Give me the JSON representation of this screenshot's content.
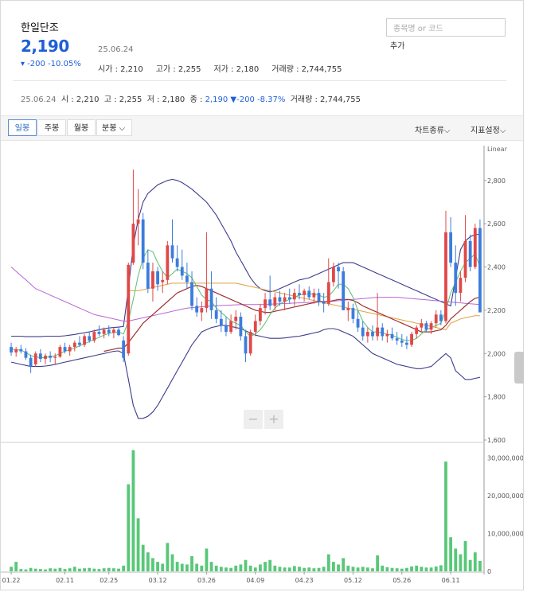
{
  "stock": {
    "name": "한일단조",
    "price": "2,190",
    "change": "-200 -10.05%",
    "date": "25.06.24",
    "open": "시가 : 2,210",
    "high": "고가 : 2,255",
    "low": "저가 : 2,180",
    "volume": "거래량 : 2,744,755"
  },
  "search": {
    "placeholder": "종목명 or 코드",
    "add_label": "추가"
  },
  "ohlc_row": {
    "date": "25.06.24",
    "open": "시 : 2,210",
    "high": "고 : 2,255",
    "low": "저 : 2,180",
    "close_label": "종 : ",
    "close_value": "2,190",
    "change": "▼-200 -8.37%",
    "volume": "거래량 : 2,744,755"
  },
  "toolbar": {
    "tabs": [
      "일봉",
      "주봉",
      "월봉",
      "분봉"
    ],
    "active_tab": "일봉",
    "chart_type": "차트종류",
    "indicator_settings": "지표설정"
  },
  "colors": {
    "up": "#e04848",
    "down": "#3b7ddd",
    "accent": "#1f5fd6",
    "bollinger": "#3c3c8c",
    "volume": "#58c878"
  },
  "chart_data": {
    "type": "candlestick",
    "scale_label": "Linear",
    "price_ylim": [
      1600,
      2950
    ],
    "price_ticks": [
      1600,
      1800,
      2000,
      2200,
      2400,
      2600,
      2800
    ],
    "volume_ylim": [
      0,
      33000000
    ],
    "volume_ticks": [
      "0",
      "10,000,000",
      "20,000,000",
      "30,000,000"
    ],
    "x_tick_labels": [
      "01.22",
      "02.11",
      "02.25",
      "03.12",
      "03.26",
      "04.09",
      "04.23",
      "05.12",
      "05.26",
      "06.11"
    ],
    "x_tick_index": [
      0,
      11,
      20,
      30,
      40,
      50,
      60,
      70,
      80,
      90
    ],
    "candles": [
      [
        2030,
        2050,
        1990,
        2005
      ],
      [
        2005,
        2030,
        1985,
        2020
      ],
      [
        2020,
        2040,
        2000,
        2010
      ],
      [
        2010,
        2025,
        1970,
        1980
      ],
      [
        1980,
        1995,
        1910,
        1940
      ],
      [
        1950,
        2010,
        1940,
        2000
      ],
      [
        2000,
        2020,
        1960,
        1975
      ],
      [
        1975,
        2000,
        1950,
        1990
      ],
      [
        1990,
        2010,
        1960,
        1980
      ],
      [
        1980,
        2000,
        1950,
        1985
      ],
      [
        1985,
        2040,
        1980,
        2030
      ],
      [
        2030,
        2050,
        2000,
        2010
      ],
      [
        2010,
        2040,
        1990,
        2030
      ],
      [
        2030,
        2060,
        2010,
        2050
      ],
      [
        2050,
        2080,
        2030,
        2040
      ],
      [
        2040,
        2090,
        2030,
        2080
      ],
      [
        2080,
        2100,
        2050,
        2060
      ],
      [
        2060,
        2110,
        2050,
        2100
      ],
      [
        2100,
        2130,
        2080,
        2090
      ],
      [
        2090,
        2120,
        2070,
        2110
      ],
      [
        2110,
        2130,
        2080,
        2095
      ],
      [
        2095,
        2120,
        2070,
        2110
      ],
      [
        2110,
        2120,
        2080,
        2085
      ],
      [
        2060,
        2080,
        1960,
        1980
      ],
      [
        2000,
        2420,
        1990,
        2410
      ],
      [
        2420,
        2850,
        2410,
        2600
      ],
      [
        2600,
        2760,
        2500,
        2620
      ],
      [
        2620,
        2650,
        2390,
        2420
      ],
      [
        2420,
        2480,
        2280,
        2300
      ],
      [
        2300,
        2420,
        2240,
        2380
      ],
      [
        2380,
        2400,
        2290,
        2320
      ],
      [
        2330,
        2380,
        2280,
        2340
      ],
      [
        2340,
        2520,
        2320,
        2500
      ],
      [
        2500,
        2620,
        2420,
        2440
      ],
      [
        2440,
        2500,
        2380,
        2400
      ],
      [
        2400,
        2480,
        2340,
        2360
      ],
      [
        2360,
        2420,
        2300,
        2330
      ],
      [
        2330,
        2380,
        2200,
        2220
      ],
      [
        2220,
        2260,
        2170,
        2190
      ],
      [
        2190,
        2240,
        2150,
        2210
      ],
      [
        2210,
        2560,
        2190,
        2300
      ],
      [
        2300,
        2380,
        2160,
        2200
      ],
      [
        2200,
        2260,
        2140,
        2160
      ],
      [
        2160,
        2200,
        2100,
        2130
      ],
      [
        2130,
        2170,
        2080,
        2100
      ],
      [
        2100,
        2180,
        2090,
        2150
      ],
      [
        2150,
        2200,
        2110,
        2170
      ],
      [
        2170,
        2190,
        2060,
        2080
      ],
      [
        2080,
        2110,
        1960,
        2000
      ],
      [
        2000,
        2110,
        1990,
        2100
      ],
      [
        2100,
        2180,
        2080,
        2150
      ],
      [
        2150,
        2230,
        2130,
        2210
      ],
      [
        2210,
        2280,
        2180,
        2250
      ],
      [
        2250,
        2360,
        2200,
        2220
      ],
      [
        2220,
        2280,
        2200,
        2260
      ],
      [
        2260,
        2290,
        2220,
        2240
      ],
      [
        2240,
        2280,
        2200,
        2260
      ],
      [
        2260,
        2300,
        2230,
        2250
      ],
      [
        2250,
        2300,
        2220,
        2280
      ],
      [
        2280,
        2320,
        2250,
        2270
      ],
      [
        2270,
        2300,
        2240,
        2290
      ],
      [
        2290,
        2310,
        2250,
        2260
      ],
      [
        2260,
        2300,
        2230,
        2280
      ],
      [
        2280,
        2300,
        2220,
        2240
      ],
      [
        2240,
        2280,
        2190,
        2230
      ],
      [
        2230,
        2440,
        2220,
        2330
      ],
      [
        2330,
        2420,
        2310,
        2400
      ],
      [
        2400,
        2420,
        2300,
        2380
      ],
      [
        2380,
        2400,
        2200,
        2200
      ],
      [
        2200,
        2240,
        2150,
        2210
      ],
      [
        2210,
        2230,
        2140,
        2160
      ],
      [
        2160,
        2200,
        2100,
        2120
      ],
      [
        2120,
        2150,
        2060,
        2080
      ],
      [
        2080,
        2120,
        2050,
        2100
      ],
      [
        2100,
        2130,
        2060,
        2080
      ],
      [
        2080,
        2280,
        2060,
        2120
      ],
      [
        2120,
        2140,
        2060,
        2080
      ],
      [
        2080,
        2110,
        2050,
        2090
      ],
      [
        2090,
        2120,
        2060,
        2070
      ],
      [
        2070,
        2100,
        2040,
        2060
      ],
      [
        2060,
        2090,
        2030,
        2050
      ],
      [
        2050,
        2080,
        2020,
        2040
      ],
      [
        2040,
        2100,
        2030,
        2090
      ],
      [
        2090,
        2130,
        2070,
        2120
      ],
      [
        2120,
        2160,
        2100,
        2140
      ],
      [
        2140,
        2150,
        2100,
        2110
      ],
      [
        2110,
        2150,
        2090,
        2140
      ],
      [
        2140,
        2200,
        2120,
        2180
      ],
      [
        2180,
        2200,
        2130,
        2150
      ],
      [
        2150,
        2660,
        2140,
        2560
      ],
      [
        2560,
        2630,
        2400,
        2420
      ],
      [
        2420,
        2500,
        2220,
        2280
      ],
      [
        2280,
        2380,
        2240,
        2350
      ],
      [
        2350,
        2640,
        2330,
        2520
      ],
      [
        2520,
        2550,
        2380,
        2400
      ],
      [
        2400,
        2600,
        2390,
        2580
      ],
      [
        2580,
        2620,
        2200,
        2190
      ]
    ],
    "ma5": [
      2020,
      2018,
      2015,
      2005,
      1990,
      1985,
      1980,
      1982,
      1985,
      1990,
      2000,
      2010,
      2018,
      2025,
      2035,
      2045,
      2055,
      2065,
      2075,
      2085,
      2092,
      2098,
      2100,
      2090,
      2150,
      2250,
      2360,
      2440,
      2480,
      2470,
      2420,
      2380,
      2350,
      2370,
      2390,
      2380,
      2370,
      2350,
      2310,
      2270,
      2250,
      2240,
      2210,
      2190,
      2170,
      2150,
      2140,
      2130,
      2100,
      2080,
      2090,
      2110,
      2140,
      2180,
      2210,
      2230,
      2240,
      2250,
      2260,
      2270,
      2275,
      2275,
      2275,
      2270,
      2260,
      2265,
      2290,
      2320,
      2320,
      2300,
      2260,
      2200,
      2150,
      2120,
      2100,
      2100,
      2095,
      2090,
      2085,
      2075,
      2065,
      2060,
      2060,
      2070,
      2090,
      2110,
      2120,
      2130,
      2140,
      2200,
      2280,
      2330,
      2380,
      2420,
      2440,
      2460,
      2400
    ],
    "ma20": [
      null,
      null,
      null,
      null,
      null,
      null,
      null,
      null,
      null,
      null,
      null,
      null,
      null,
      null,
      null,
      null,
      null,
      null,
      null,
      2010,
      2015,
      2020,
      2025,
      2025,
      2050,
      2080,
      2110,
      2140,
      2160,
      2180,
      2200,
      2220,
      2240,
      2260,
      2280,
      2290,
      2300,
      2310,
      2315,
      2310,
      2300,
      2290,
      2280,
      2270,
      2260,
      2250,
      2240,
      2230,
      2220,
      2210,
      2200,
      2195,
      2190,
      2190,
      2195,
      2200,
      2205,
      2210,
      2215,
      2220,
      2225,
      2230,
      2235,
      2240,
      2240,
      2240,
      2245,
      2250,
      2250,
      2250,
      2245,
      2235,
      2220,
      2210,
      2200,
      2190,
      2180,
      2170,
      2160,
      2150,
      2140,
      2130,
      2120,
      2110,
      2100,
      2100,
      2100,
      2105,
      2110,
      2130,
      2160,
      2180,
      2200,
      2220,
      2240,
      2255,
      2260
    ],
    "ma60": [
      2400,
      2380,
      2360,
      2340,
      2320,
      2300,
      2290,
      2280,
      2270,
      2260,
      2250,
      2240,
      2230,
      2220,
      2210,
      2200,
      2190,
      2180,
      2175,
      2170,
      2165,
      2160,
      2155,
      2150,
      2150,
      2155,
      2160,
      2165,
      2170,
      2175,
      2180,
      2185,
      2190,
      2195,
      2200,
      2205,
      2210,
      2212,
      2214,
      2216,
      2218,
      2220,
      2221,
      2222,
      2223,
      2224,
      2225,
      2226,
      2226,
      2226,
      2226,
      2226,
      2227,
      2228,
      2229,
      2230,
      2231,
      2232,
      2233,
      2234,
      2235,
      2236,
      2237,
      2238,
      2239,
      2240,
      2242,
      2244,
      2246,
      2248,
      2250,
      2252,
      2254,
      2256,
      2258,
      2260,
      2260,
      2260,
      2260,
      2260,
      2258,
      2256,
      2254,
      2252,
      2250,
      2248,
      2246,
      2244,
      2242,
      2240,
      2238,
      2236,
      2234,
      2232,
      2230,
      2228,
      2226
    ],
    "ma120": [
      null,
      null,
      null,
      null,
      null,
      null,
      null,
      null,
      null,
      null,
      null,
      null,
      null,
      null,
      null,
      null,
      null,
      null,
      null,
      null,
      null,
      null,
      null,
      null,
      2290,
      2290,
      2290,
      2295,
      2300,
      2305,
      2310,
      2315,
      2320,
      2325,
      2325,
      2325,
      2325,
      2325,
      2325,
      2325,
      2325,
      2325,
      2325,
      2325,
      2325,
      2325,
      2325,
      2320,
      2315,
      2310,
      2305,
      2300,
      2295,
      2290,
      2285,
      2280,
      2275,
      2270,
      2265,
      2260,
      2255,
      2250,
      2245,
      2240,
      2235,
      2230,
      2225,
      2220,
      2215,
      2210,
      2205,
      2200,
      2195,
      2190,
      2185,
      2180,
      2175,
      2170,
      2165,
      2160,
      2155,
      2150,
      2145,
      2140,
      2135,
      2130,
      2125,
      2120,
      2115,
      2110,
      2140,
      2150,
      2160,
      2165,
      2170,
      2175,
      2175
    ],
    "bollinger_upper": [
      2080,
      2080,
      2080,
      2078,
      2078,
      2078,
      2078,
      2080,
      2080,
      2080,
      2080,
      2082,
      2085,
      2088,
      2092,
      2096,
      2100,
      2105,
      2110,
      2115,
      2118,
      2120,
      2122,
      2125,
      2300,
      2500,
      2620,
      2700,
      2740,
      2760,
      2780,
      2790,
      2800,
      2805,
      2800,
      2790,
      2775,
      2760,
      2740,
      2720,
      2700,
      2670,
      2640,
      2600,
      2560,
      2520,
      2470,
      2430,
      2390,
      2350,
      2320,
      2300,
      2290,
      2285,
      2290,
      2300,
      2310,
      2320,
      2330,
      2340,
      2345,
      2350,
      2360,
      2370,
      2380,
      2390,
      2400,
      2410,
      2420,
      2420,
      2420,
      2410,
      2400,
      2390,
      2380,
      2370,
      2360,
      2350,
      2340,
      2330,
      2320,
      2310,
      2300,
      2290,
      2280,
      2270,
      2260,
      2250,
      2240,
      2230,
      2220,
      2350,
      2480,
      2520,
      2540,
      2550,
      2550
    ],
    "bollinger_lower": [
      1960,
      1955,
      1950,
      1945,
      1940,
      1940,
      1940,
      1942,
      1945,
      1950,
      1955,
      1960,
      1965,
      1970,
      1975,
      1980,
      1985,
      1990,
      1995,
      2000,
      2005,
      2010,
      2012,
      2000,
      1880,
      1760,
      1700,
      1700,
      1710,
      1730,
      1760,
      1800,
      1840,
      1880,
      1920,
      1960,
      2000,
      2040,
      2070,
      2100,
      2110,
      2120,
      2125,
      2130,
      2130,
      2125,
      2120,
      2115,
      2105,
      2095,
      2085,
      2080,
      2075,
      2070,
      2070,
      2070,
      2072,
      2075,
      2078,
      2080,
      2085,
      2090,
      2095,
      2100,
      2110,
      2115,
      2115,
      2110,
      2100,
      2090,
      2080,
      2060,
      2040,
      2020,
      2000,
      1990,
      1980,
      1970,
      1960,
      1950,
      1945,
      1940,
      1935,
      1930,
      1930,
      1935,
      1940,
      1960,
      1980,
      2000,
      1980,
      1920,
      1900,
      1880,
      1880,
      1885,
      1890
    ],
    "volume": [
      1200000,
      2500000,
      600000,
      500000,
      900000,
      700000,
      600000,
      500000,
      800000,
      700000,
      900000,
      600000,
      800000,
      1200000,
      700000,
      800000,
      900000,
      700000,
      600000,
      800000,
      900000,
      800000,
      700000,
      1500000,
      23000000,
      32000000,
      14000000,
      7000000,
      5000000,
      3500000,
      2500000,
      2000000,
      7500000,
      4500000,
      2500000,
      2000000,
      1800000,
      4000000,
      2000000,
      1500000,
      6000000,
      2500000,
      1500000,
      1200000,
      1000000,
      900000,
      1500000,
      1800000,
      3000000,
      1500000,
      1000000,
      1800000,
      2500000,
      3000000,
      1500000,
      1200000,
      1000000,
      1000000,
      1400000,
      1200000,
      900000,
      1000000,
      800000,
      900000,
      1200000,
      4500000,
      2500000,
      1800000,
      3500000,
      1500000,
      1200000,
      1000000,
      1200000,
      1000000,
      800000,
      4200000,
      1500000,
      1100000,
      900000,
      800000,
      700000,
      900000,
      1300000,
      1500000,
      1200000,
      1000000,
      1000000,
      1300000,
      1600000,
      29000000,
      9000000,
      6000000,
      4500000,
      8000000,
      3000000,
      5000000,
      2744755
    ]
  }
}
